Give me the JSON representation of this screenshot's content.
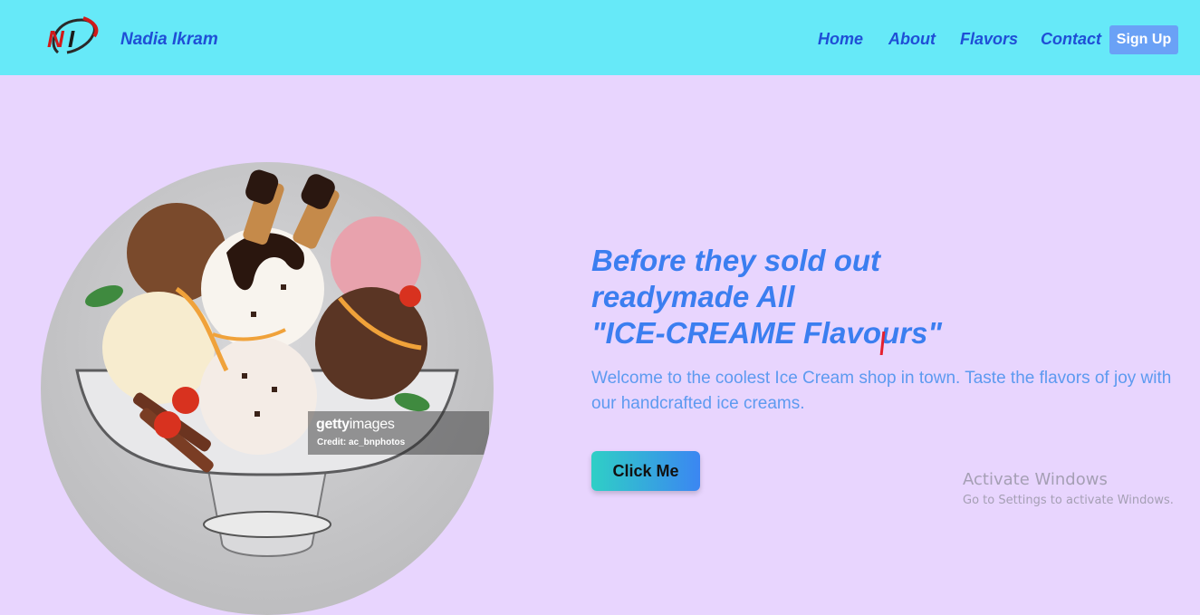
{
  "navbar": {
    "logo_text": "NI",
    "brand": "Nadia Ikram",
    "links": [
      {
        "label": "Home"
      },
      {
        "label": "About"
      },
      {
        "label": "Flavors"
      },
      {
        "label": "Contact"
      }
    ],
    "signup_label": "Sign Up"
  },
  "hero": {
    "image_alt": "ice cream sundae",
    "watermark_brand_bold": "getty",
    "watermark_brand_light": "images",
    "watermark_credit": "Credit: ac_bnphotos",
    "headline_lines": [
      "Before they sold out",
      "readymade All",
      "\"ICE-CREAME Flavours\""
    ],
    "subtitle": "Welcome to the coolest Ice Cream shop in town. Taste the flavors of joy with our handcrafted ice creams.",
    "cta_label": "Click Me"
  },
  "os_overlay": {
    "title": "Activate Windows",
    "subtitle": "Go to Settings to activate Windows."
  },
  "colors": {
    "navbar_bg": "#66e9f8",
    "page_bg": "#e8d5fe",
    "nav_text": "#1f4fd6",
    "headline": "#3b7ef0",
    "signup_bg": "#6aa1f6"
  }
}
